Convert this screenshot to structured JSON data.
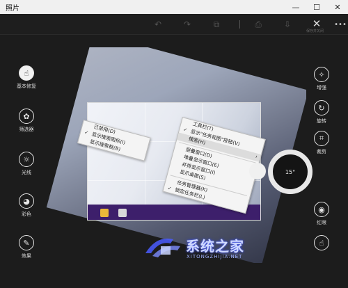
{
  "window": {
    "title": "照片",
    "minimize": "—",
    "maximize": "☐",
    "close": "✕"
  },
  "toolbar": {
    "undo_icon": "↶",
    "redo_icon": "↷",
    "compare_icon": "⧉",
    "save_copy_icon": "⎙",
    "save_icon": "⇩",
    "close_icon": "✕",
    "more_icon": "•••",
    "close_caption": "保存并关闭"
  },
  "left_tools": [
    {
      "label": "基本修复",
      "icon": "☝"
    },
    {
      "label": "筛选器",
      "icon": "✿"
    },
    {
      "label": "光线",
      "icon": "☼"
    },
    {
      "label": "彩色",
      "icon": "◕"
    },
    {
      "label": "效果",
      "icon": "✎"
    }
  ],
  "right_tools": [
    {
      "label": "增强",
      "icon": "✧"
    },
    {
      "label": "旋转",
      "icon": "↻"
    },
    {
      "label": "裁剪",
      "icon": "⌗"
    },
    {
      "label": "红眼",
      "icon": "◉"
    },
    {
      "label": "",
      "icon": "☝"
    }
  ],
  "menu_left": [
    {
      "label": "已禁用(D)",
      "checked": false
    },
    {
      "label": "显示搜索图标(I)",
      "checked": true
    },
    {
      "label": "显示搜索框(B)",
      "checked": false
    }
  ],
  "menu_right": [
    {
      "label": "工具栏(T)",
      "checked": false,
      "arrow": false
    },
    {
      "label": "显示\"任务视图\"按钮(V)",
      "checked": true,
      "arrow": false
    },
    {
      "label": "搜索(H)",
      "checked": false,
      "arrow": true
    },
    {
      "label": "层叠窗口(D)",
      "checked": false,
      "arrow": false
    },
    {
      "label": "堆叠显示窗口(E)",
      "checked": false,
      "arrow": false
    },
    {
      "label": "并排显示窗口(I)",
      "checked": false,
      "arrow": false
    },
    {
      "label": "显示桌面(S)",
      "checked": false,
      "arrow": false
    },
    {
      "label": "任务管理器(K)",
      "checked": false,
      "arrow": false
    },
    {
      "label": "锁定任务栏(L)",
      "checked": true,
      "arrow": false
    }
  ],
  "dial": {
    "angle_text": "15°"
  },
  "watermark": {
    "text": "系统之家",
    "sub": "XITONGZHIJIA.NET"
  },
  "colors": {
    "background": "#1c1c1c",
    "titlebar": "#f0f0f0",
    "taskbar": "#3d1f6b"
  }
}
